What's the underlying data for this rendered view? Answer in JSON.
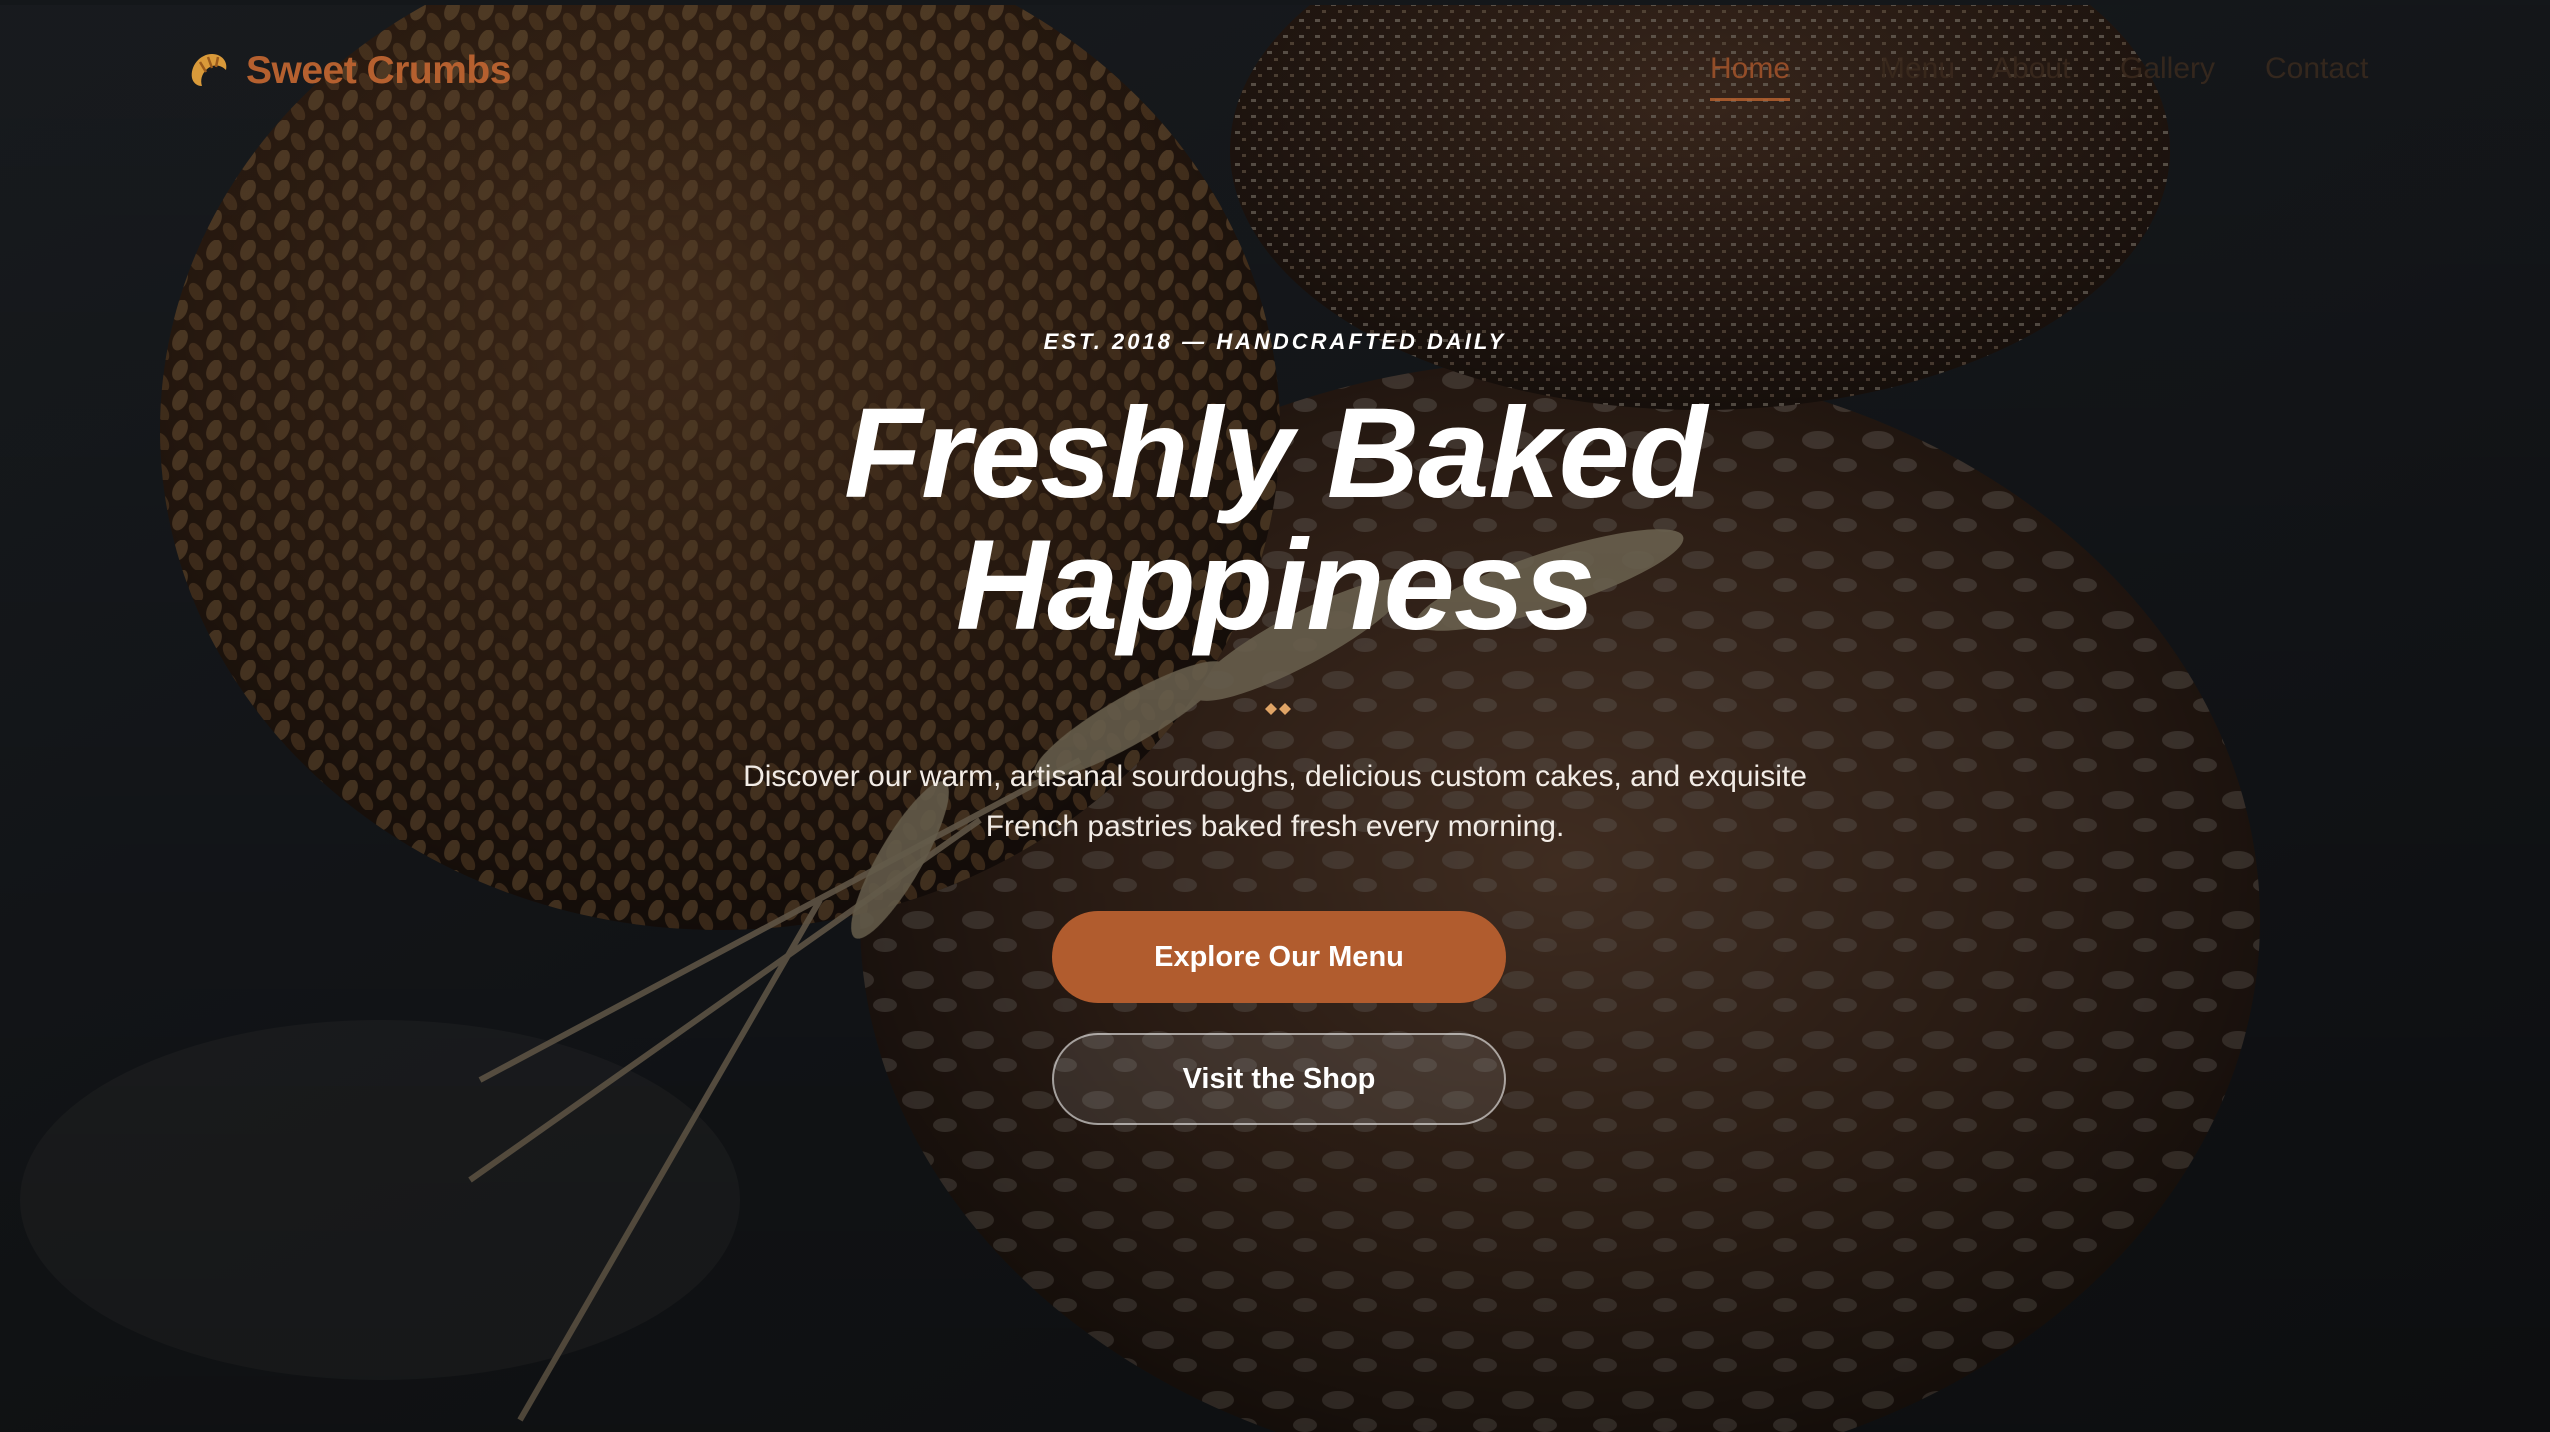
{
  "brand": {
    "name": "Sweet Crumbs",
    "logo_icon": "croissant-icon",
    "color": "#b5602f"
  },
  "nav": {
    "items": [
      {
        "label": "Home",
        "active": true
      },
      {
        "label": "Menu",
        "active": false
      },
      {
        "label": "About",
        "active": false
      },
      {
        "label": "Gallery",
        "active": false
      },
      {
        "label": "Contact",
        "active": false
      }
    ]
  },
  "hero": {
    "eyebrow": "EST. 2018 — HANDCRAFTED DAILY",
    "headline_line1": "Freshly Baked",
    "headline_line2": "Happiness",
    "divider_icon": "wheat-diamond-icon",
    "description": "Discover our warm, artisanal sourdoughs, delicious custom cakes, and exquisite French pastries baked fresh every morning.",
    "primary_cta": "Explore Our Menu",
    "secondary_cta": "Visit the Shop",
    "accent_color": "#b15c2e"
  }
}
